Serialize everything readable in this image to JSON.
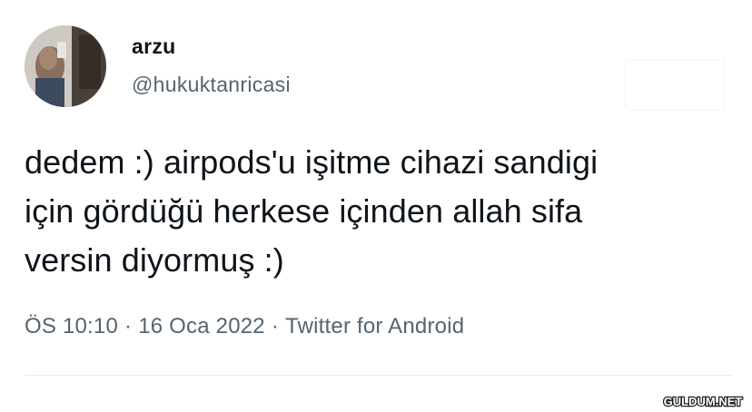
{
  "tweet": {
    "author_name": "arzu",
    "author_handle": "@hukuktanricasi",
    "text_lines": [
      "dedem :) airpods'u işitme cihazi sandigi",
      "için gördüğü herkese içinden allah sifa",
      "versin diyormuş :)"
    ],
    "time": "ÖS 10:10",
    "date": "16 Oca 2022",
    "source": "Twitter for Android",
    "separator": "·"
  },
  "watermark": {
    "text": "GULDUM.NET"
  },
  "colors": {
    "primary_text": "#0f1419",
    "secondary_text": "#536471",
    "divider": "#e6ecf0"
  },
  "icons": {
    "avatar": "profile-photo"
  }
}
